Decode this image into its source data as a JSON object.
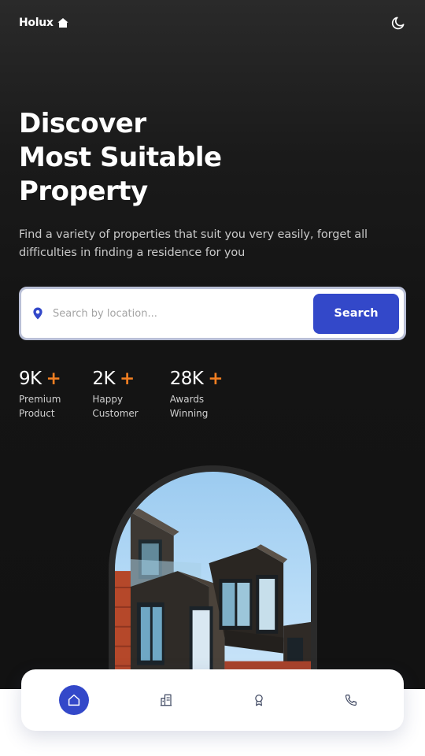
{
  "brand": {
    "name": "Holux",
    "icon": "home-icon"
  },
  "theme_toggle": {
    "icon": "moon-icon"
  },
  "hero": {
    "title_lines": [
      "Discover",
      "Most Suitable",
      "Property"
    ],
    "subtitle": "Find a variety of properties that suit you very easily, forget all difficulties in finding a residence for you"
  },
  "search": {
    "icon": "location-pin-icon",
    "placeholder": "Search by location...",
    "value": "",
    "button_label": "Search"
  },
  "stats": [
    {
      "value": "9K",
      "plus": "+",
      "label_1": "Premium",
      "label_2": "Product"
    },
    {
      "value": "2K",
      "plus": "+",
      "label_1": "Happy",
      "label_2": "Customer"
    },
    {
      "value": "28K",
      "plus": "+",
      "label_1": "Awards",
      "label_2": "Winning"
    }
  ],
  "nav": [
    {
      "icon": "home-icon",
      "active": true
    },
    {
      "icon": "building-icon",
      "active": false
    },
    {
      "icon": "award-icon",
      "active": false
    },
    {
      "icon": "phone-icon",
      "active": false
    }
  ],
  "colors": {
    "accent": "#3348c9",
    "plus": "#f07e22",
    "background_dark": "#121212"
  }
}
